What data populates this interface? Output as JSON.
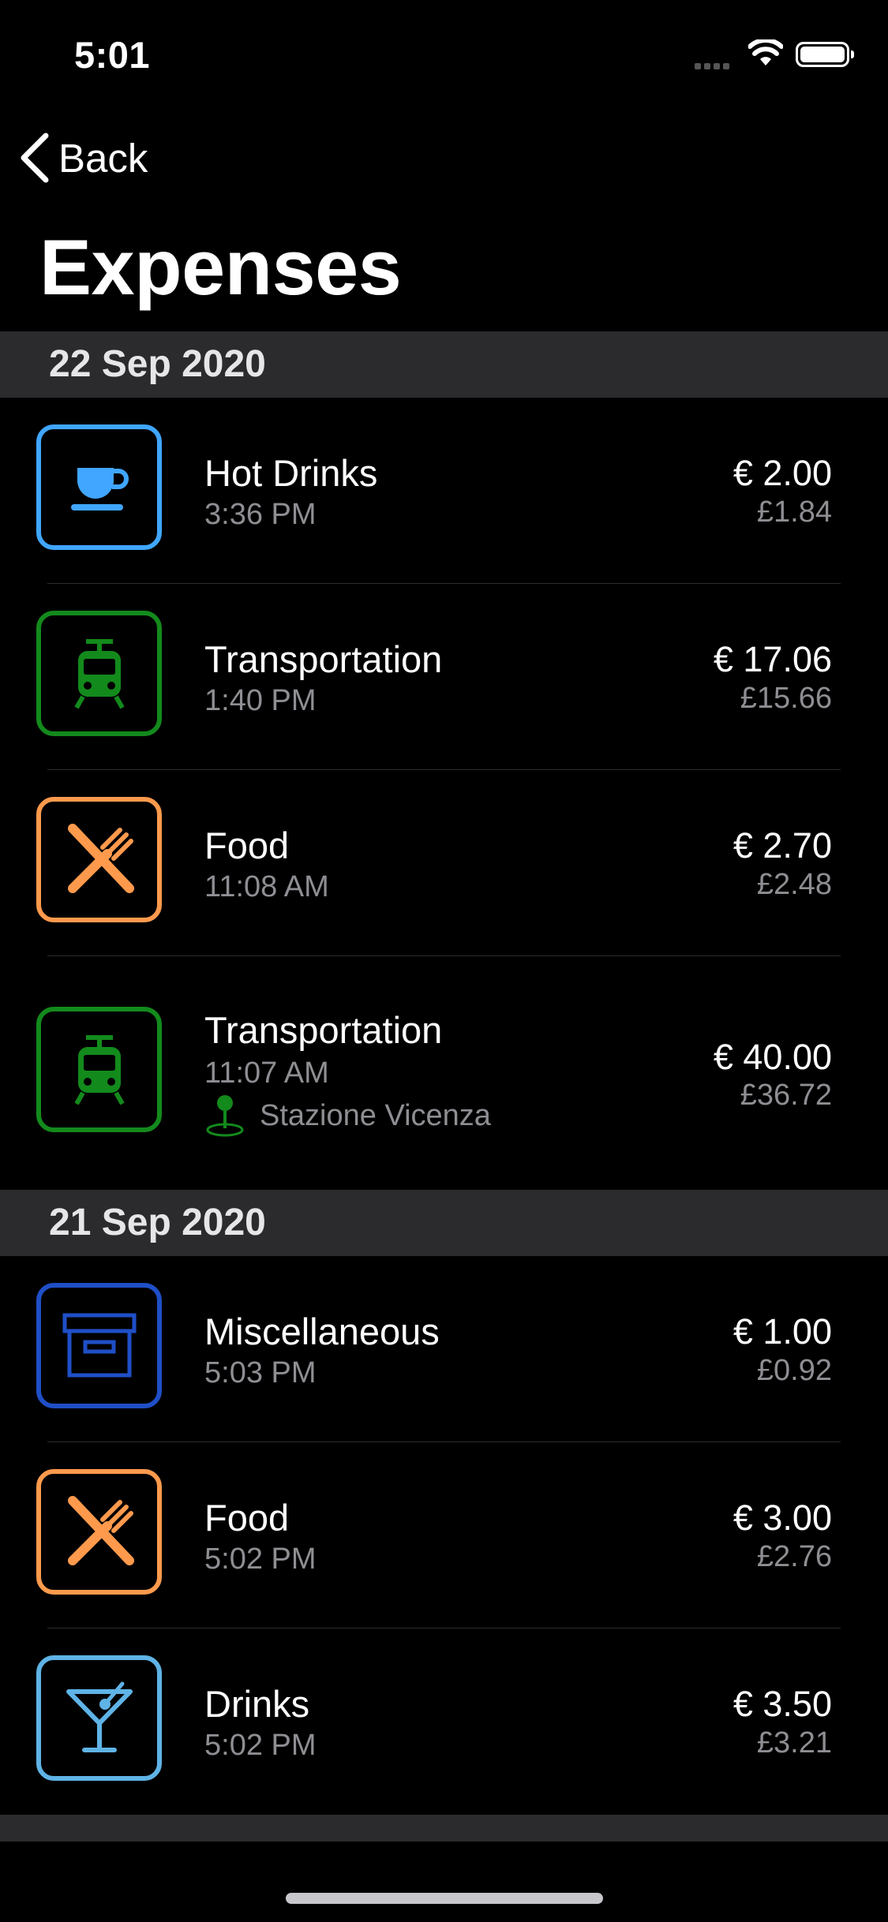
{
  "status_bar": {
    "time": "5:01"
  },
  "nav": {
    "back_label": "Back"
  },
  "page": {
    "title": "Expenses"
  },
  "colors": {
    "hot_drinks": "#40a6ff",
    "transportation": "#138a1c",
    "food": "#ff9a4d",
    "miscellaneous": "#1f4fc7",
    "drinks": "#5fb3e6"
  },
  "sections": [
    {
      "date": "22 Sep 2020",
      "items": [
        {
          "icon": "coffee-cup-icon",
          "title": "Hot Drinks",
          "time": "3:36 PM",
          "eur": "€ 2.00",
          "gbp": "£1.84"
        },
        {
          "icon": "train-icon",
          "title": "Transportation",
          "time": "1:40 PM",
          "eur": "€ 17.06",
          "gbp": "£15.66"
        },
        {
          "icon": "fork-knife-icon",
          "title": "Food",
          "time": "11:08 AM",
          "eur": "€ 2.70",
          "gbp": "£2.48"
        },
        {
          "icon": "train-icon",
          "title": "Transportation",
          "time": "11:07 AM",
          "location": "Stazione Vicenza",
          "eur": "€ 40.00",
          "gbp": "£36.72"
        }
      ]
    },
    {
      "date": "21 Sep 2020",
      "items": [
        {
          "icon": "archive-box-icon",
          "title": "Miscellaneous",
          "time": "5:03 PM",
          "eur": "€ 1.00",
          "gbp": "£0.92"
        },
        {
          "icon": "fork-knife-icon",
          "title": "Food",
          "time": "5:02 PM",
          "eur": "€ 3.00",
          "gbp": "£2.76"
        },
        {
          "icon": "cocktail-icon",
          "title": "Drinks",
          "time": "5:02 PM",
          "eur": "€ 3.50",
          "gbp": "£3.21"
        }
      ]
    }
  ]
}
